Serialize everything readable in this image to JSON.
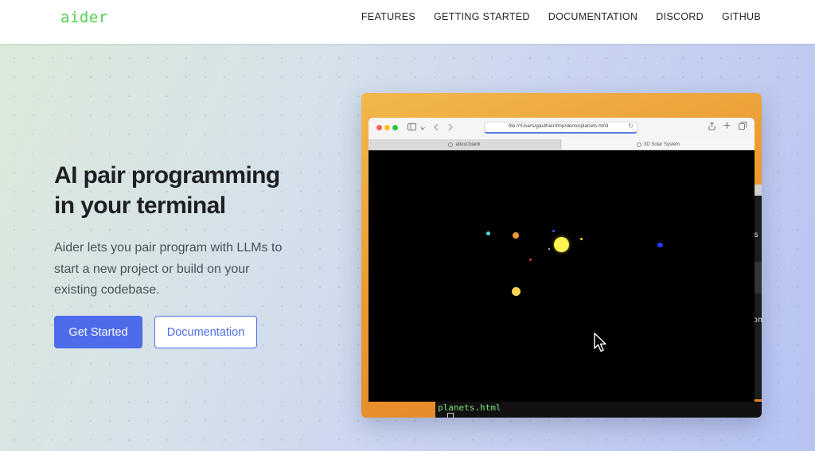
{
  "header": {
    "logo": "aider",
    "nav": [
      "FEATURES",
      "GETTING STARTED",
      "DOCUMENTATION",
      "DISCORD",
      "GITHUB"
    ]
  },
  "hero": {
    "title_line1": "AI pair programming",
    "title_line2": "in your terminal",
    "description": "Aider lets you pair program with LLMs to start a new project or build on your existing codebase.",
    "primary_button": "Get Started",
    "secondary_button": "Documentation"
  },
  "demo": {
    "browser_url": "file:///Users/gauthier/tmp/demo/planets.html",
    "tabs": [
      "about:blank",
      "3D Solar System"
    ],
    "terminal_text": "planets.html",
    "terminal_trail_1": "s",
    "terminal_trail_2": "on"
  },
  "colors": {
    "accent": "#4d6bea",
    "logo": "#5fd15a",
    "title": "#1c1f24",
    "body_text": "#4a5058"
  },
  "icons": {
    "back": "chevron-left-icon",
    "forward": "chevron-right-icon",
    "sidebar": "sidebar-icon",
    "share": "share-icon",
    "new_tab": "plus-icon",
    "tabs_overview": "tabs-icon",
    "reload": "reload-icon",
    "cursor": "mouse-pointer-icon"
  }
}
